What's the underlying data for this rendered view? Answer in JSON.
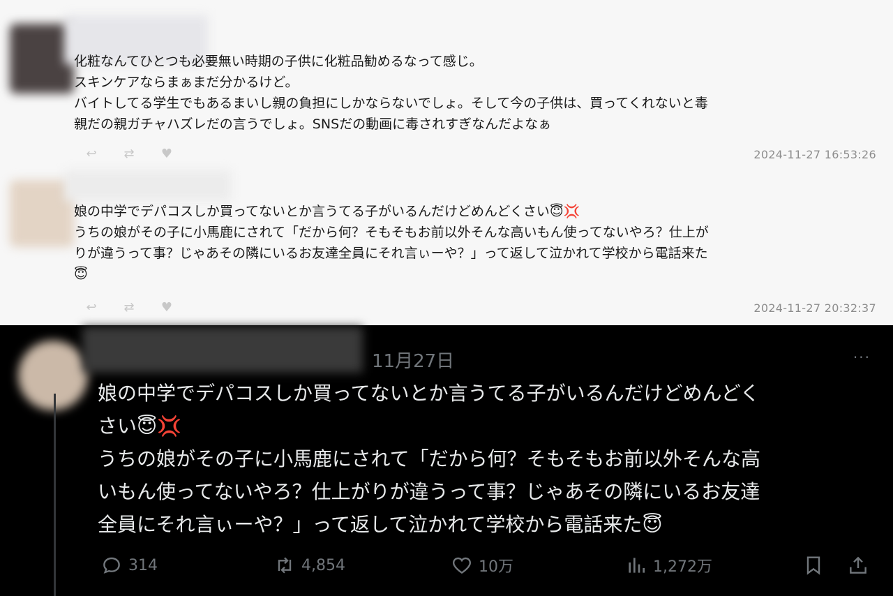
{
  "post1": {
    "text": "化粧なんてひとつも必要無い時期の子供に化粧品勧めるなって感じ。\nスキンケアならまぁまだ分かるけど。\nバイトしてる学生でもあるまいし親の負担にしかならないでしょ。そして今の子供は、買ってくれないと毒\n親だの親ガチャハズレだの言うでしょ。SNSだの動画に毒されすぎなんだよなぁ",
    "timestamp": "2024-11-27 16:53:26"
  },
  "post2": {
    "text": "娘の中学でデパコスしか買ってないとか言うてる子がいるんだけどめんどくさい😇💢\nうちの娘がその子に小馬鹿にされて「だから何？そもそもお前以外そんな高いもん使ってないやろ？仕上が\nりが違うって事？じゃあその隣にいるお友達全員にそれ言ぃーや？」って返して泣かれて学校から電話来た\n😇",
    "timestamp": "2024-11-27 20:32:37"
  },
  "tweet": {
    "date": "11月27日",
    "more": "···",
    "text": "娘の中学でデパコスしか買ってないとか言うてる子がいるんだけどめんどく\nさい😇💢\nうちの娘がその子に小馬鹿にされて「だから何？そもそもお前以外そんな高\nいもん使ってないやろ？仕上がりが違うって事？じゃあその隣にいるお友達\n全員にそれ言ぃーや？」って返して泣かれて学校から電話来た😇",
    "replies": "314",
    "retweets": "4,854",
    "likes": "10万",
    "views": "1,272万"
  }
}
